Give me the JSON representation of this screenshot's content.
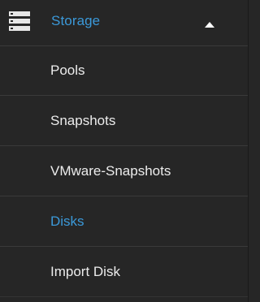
{
  "nav": {
    "section": {
      "label": "Storage",
      "icon": "storage-icon",
      "expanded": true,
      "accent_color": "#3b99d9"
    },
    "items": [
      {
        "label": "Pools",
        "active": false
      },
      {
        "label": "Snapshots",
        "active": false
      },
      {
        "label": "VMware-Snapshots",
        "active": false
      },
      {
        "label": "Disks",
        "active": true
      },
      {
        "label": "Import Disk",
        "active": false
      }
    ]
  }
}
